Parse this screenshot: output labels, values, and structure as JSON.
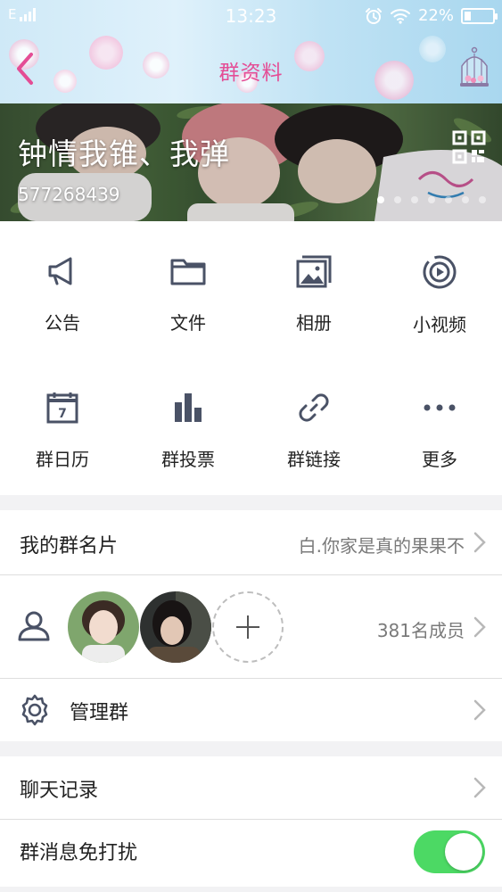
{
  "status_bar": {
    "network": "E",
    "time": "13:23",
    "battery": "22%",
    "battery_level": 0.22
  },
  "header": {
    "title": "群资料",
    "back_icon": "chevron-left-icon",
    "right_icon": "birdcage-icon"
  },
  "banner": {
    "group_name": "钟情我锥、我弹",
    "group_id": "577268439",
    "page_count": 7,
    "active_page": 0
  },
  "features": [
    {
      "label": "公告",
      "icon": "megaphone-icon"
    },
    {
      "label": "文件",
      "icon": "folder-icon"
    },
    {
      "label": "相册",
      "icon": "album-icon"
    },
    {
      "label": "小视频",
      "icon": "video-icon"
    },
    {
      "label": "群日历",
      "icon": "calendar-icon"
    },
    {
      "label": "群投票",
      "icon": "poll-icon"
    },
    {
      "label": "群链接",
      "icon": "link-icon"
    },
    {
      "label": "更多",
      "icon": "more-icon"
    }
  ],
  "calendar_day": "7",
  "group_card": {
    "label": "我的群名片",
    "value": "白.你家是真的果果不"
  },
  "members": {
    "count_text": "381名成员"
  },
  "manage": {
    "label": "管理群"
  },
  "chat_history": {
    "label": "聊天记录"
  },
  "do_not_disturb": {
    "label": "群消息免打扰",
    "enabled": true
  },
  "colors": {
    "accent": "#e44d95",
    "icon": "#4a5266",
    "toggle_on": "#4cd964"
  }
}
